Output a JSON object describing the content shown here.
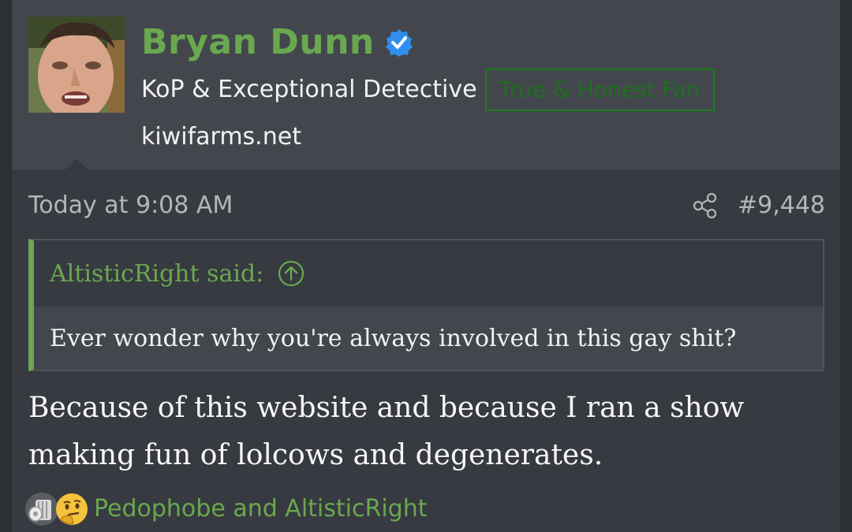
{
  "user": {
    "name": "Bryan Dunn",
    "verified_icon": "verified-badge-icon",
    "title": "KoP & Exceptional Detective",
    "badge": "True & Honest Fan",
    "site": "kiwifarms.net"
  },
  "post": {
    "date": "Today at 9:08 AM",
    "number": "#9,448",
    "share_icon": "share-icon"
  },
  "quote": {
    "author_line": "AltisticRight said:",
    "text": "Ever wonder why you're always involved in this gay shit?"
  },
  "message": {
    "line1": "Because of this website and because I ran a show",
    "line2": "making fun of lolcows and degenerates."
  },
  "reactions": {
    "icons": [
      "toilet-paper-icon",
      "thinking-face-icon"
    ],
    "names": "Pedophobe and AltisticRight"
  },
  "colors": {
    "accent": "#6aa84f",
    "badge": "#1f7a1f",
    "verified": "#2f8ff0",
    "header_bg": "#43474d",
    "post_bg": "#373a40"
  }
}
